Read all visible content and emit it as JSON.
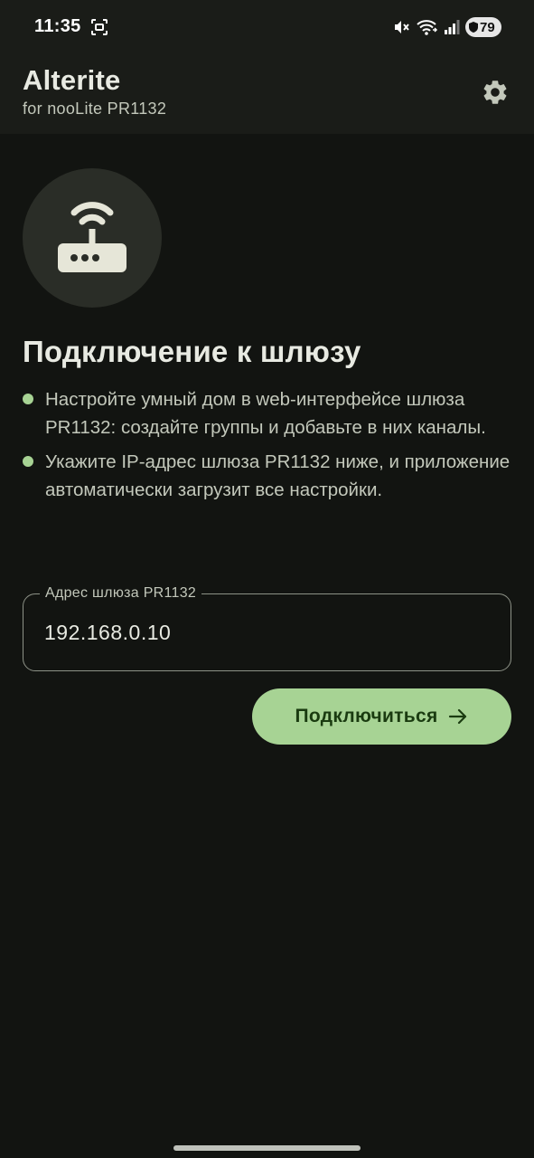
{
  "status_bar": {
    "time": "11:35",
    "battery_level": "79",
    "icons": [
      "screenshot-icon",
      "mute-icon",
      "wifi-icon",
      "signal-icon",
      "battery-icon"
    ]
  },
  "app_bar": {
    "title": "Alterite",
    "subtitle": "for nooLite PR1132",
    "settings_icon": "gear-icon"
  },
  "hero_icon": "router-icon",
  "page_title": "Подключение к шлюзу",
  "instructions": [
    "Настройте умный дом в web-интерфейсе шлюза PR1132: создайте группы и добавьте в них каналы.",
    "Укажите IP-адрес шлюза PR1132 ниже, и приложение автоматически загрузит все настройки."
  ],
  "gateway_field": {
    "label": "Адрес шлюза PR1132",
    "value": "192.168.0.10"
  },
  "connect_button": {
    "label": "Подключиться",
    "icon": "arrow-right-icon"
  },
  "colors": {
    "background": "#121411",
    "surface": "#1a1c18",
    "accent": "#a7d394",
    "on_accent": "#1a3b10",
    "text_primary": "#e8eae2",
    "text_secondary": "#c3c8bb"
  }
}
